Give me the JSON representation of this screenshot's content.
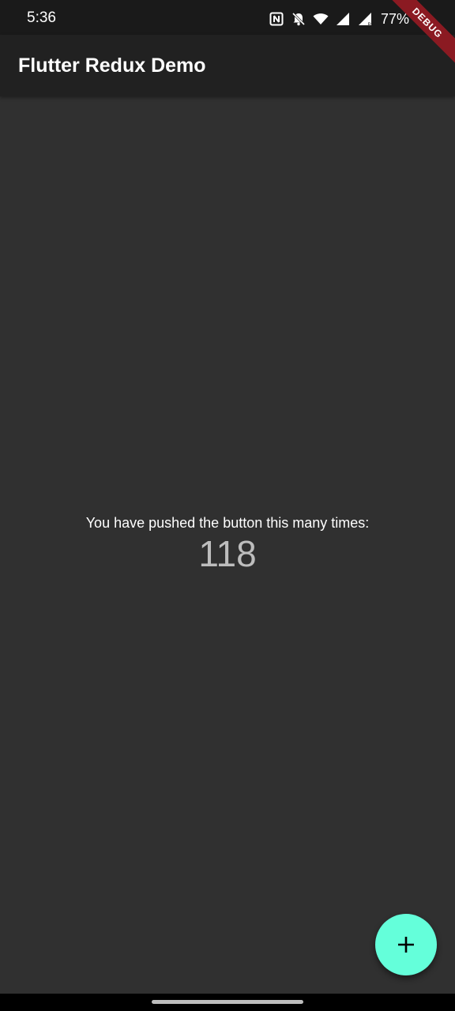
{
  "status_bar": {
    "time": "5:36",
    "battery": "77%",
    "icons": [
      "nfc-icon",
      "notifications-off-icon",
      "wifi-icon",
      "signal-icon",
      "signal-roaming-icon"
    ]
  },
  "debug_banner": {
    "label": "DEBUG"
  },
  "app_bar": {
    "title": "Flutter Redux Demo"
  },
  "main": {
    "label": "You have pushed the button this many times:",
    "counter": "118"
  },
  "fab": {
    "icon": "add-icon",
    "color": "#64ffda"
  },
  "colors": {
    "background": "#303030",
    "app_bar": "#212121",
    "status_bar": "#1a1a1a",
    "debug_banner": "#8b1a22"
  }
}
